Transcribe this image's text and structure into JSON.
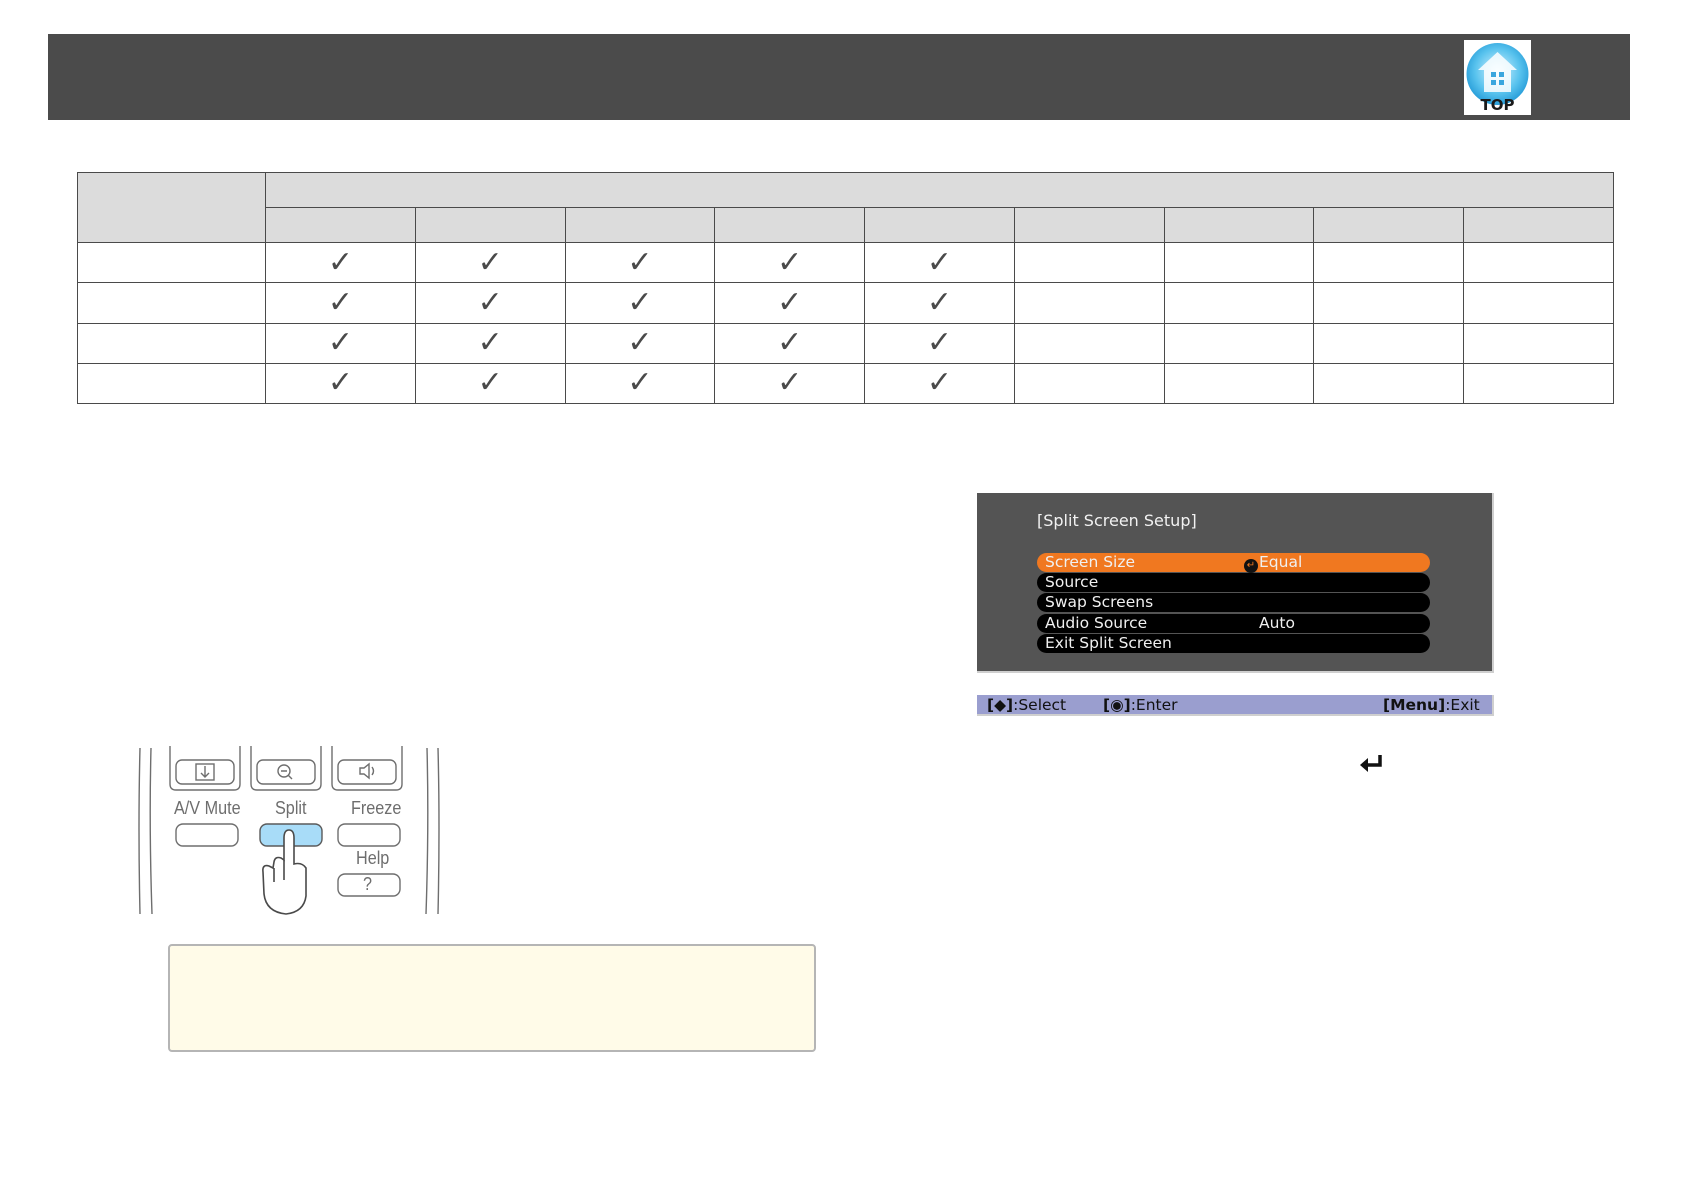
{
  "header": {
    "top_button_label": "TOP"
  },
  "table": {
    "sub_header_columns": 9,
    "rows": [
      {
        "checks": [
          "✓",
          "✓",
          "✓",
          "✓",
          "✓",
          "",
          "",
          "",
          ""
        ]
      },
      {
        "checks": [
          "✓",
          "✓",
          "✓",
          "✓",
          "✓",
          "",
          "",
          "",
          ""
        ]
      },
      {
        "checks": [
          "✓",
          "✓",
          "✓",
          "✓",
          "✓",
          "",
          "",
          "",
          ""
        ]
      },
      {
        "checks": [
          "✓",
          "✓",
          "✓",
          "✓",
          "✓",
          "",
          "",
          "",
          ""
        ]
      }
    ]
  },
  "remote": {
    "buttons": {
      "av_mute": "A/V Mute",
      "split": "Split",
      "freeze": "Freeze",
      "help": "Help",
      "help_symbol": "?"
    },
    "icons": [
      "source-search-icon",
      "zoom-out-icon",
      "volume-icon",
      "pointing-hand-icon"
    ]
  },
  "osd": {
    "title": "[Split Screen Setup]",
    "items": [
      {
        "label": "Screen Size",
        "value": "Equal",
        "selected": true
      },
      {
        "label": "Source",
        "value": ""
      },
      {
        "label": "Swap Screens",
        "value": ""
      },
      {
        "label": "Audio Source",
        "value": "Auto"
      },
      {
        "label": "Exit Split Screen",
        "value": ""
      }
    ],
    "guide": {
      "select_key": "[◆]",
      "select_text": ":Select",
      "enter_key": "[◉]",
      "enter_text": ":Enter",
      "exit_key": "[Menu]",
      "exit_text": ":Exit"
    }
  },
  "colors": {
    "header": "#4b4b4b",
    "osd_background": "#545454",
    "osd_selected": "#f07820",
    "guide_bar": "#9a9ecf",
    "note_background": "#fffbe8"
  }
}
